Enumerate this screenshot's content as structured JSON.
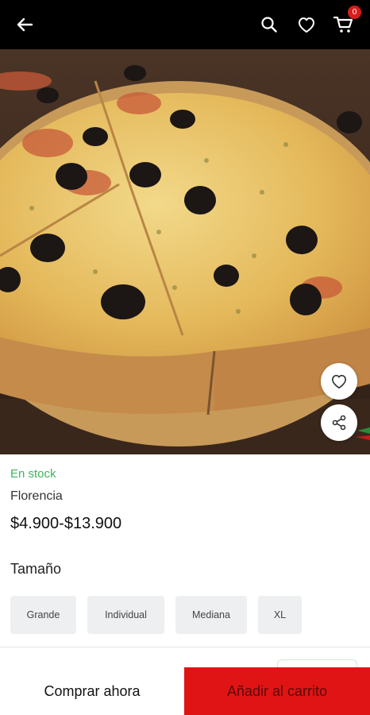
{
  "header": {
    "cart_count": "0",
    "icons": [
      "back-arrow-icon",
      "search-icon",
      "heart-icon",
      "cart-icon"
    ]
  },
  "product": {
    "stock": "En stock",
    "name": "Florencia",
    "price": "$4.900-$13.900",
    "image_icon": "pizza-image",
    "size_label": "Tamaño",
    "sizes": [
      "Grande",
      "Individual",
      "Mediana",
      "XL"
    ]
  },
  "actions": {
    "buy_now": "Comprar ahora",
    "add_to_cart": "Añadir al carrito"
  },
  "colors": {
    "topbar": "#000000",
    "accent_red": "#e01414",
    "stock_green": "#3cb55a",
    "chip_bg": "#eeeff1"
  }
}
